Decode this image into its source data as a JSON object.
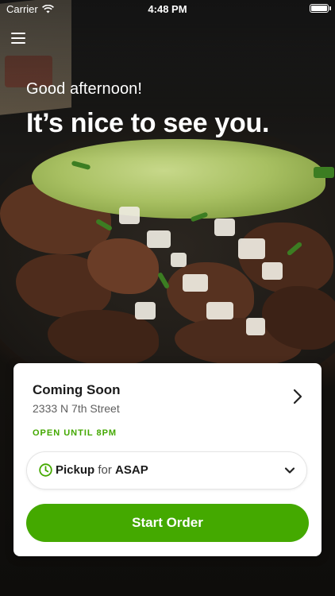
{
  "status_bar": {
    "carrier": "Carrier",
    "time": "4:48 PM"
  },
  "greeting": "Good afternoon!",
  "headline": "It’s nice to see you.",
  "location": {
    "name": "Coming Soon",
    "address": "2333 N 7th Street",
    "hours_status": "OPEN UNTIL 8PM"
  },
  "order_mode": {
    "mode": "Pickup",
    "connector": "for",
    "time": "ASAP"
  },
  "start_button": "Start Order",
  "colors": {
    "accent": "#44a900",
    "open_text": "#43a800"
  },
  "icons": [
    "wifi-icon",
    "battery-icon",
    "menu-icon",
    "chevron-right-icon",
    "clock-icon",
    "chevron-down-icon"
  ]
}
